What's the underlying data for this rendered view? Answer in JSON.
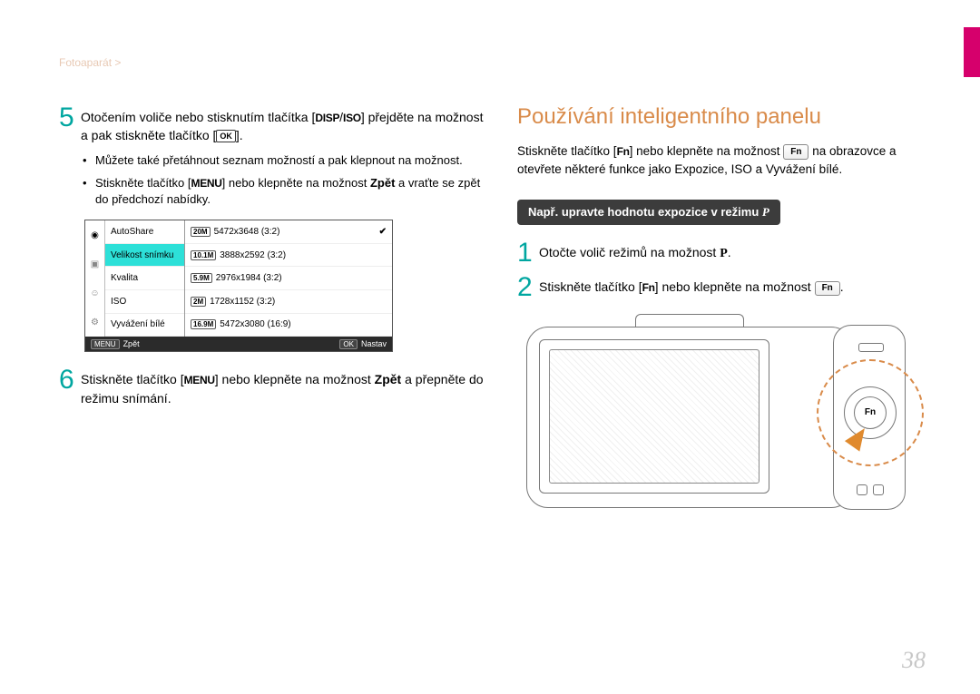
{
  "breadcrumb": "Fotoaparát >",
  "page_number": "38",
  "left": {
    "step5": {
      "num": "5",
      "pre": "Otočením voliče nebo stisknutím tlačítka [",
      "disp": "DISP",
      "slash": "/",
      "iso": "ISO",
      "mid": "] přejděte na možnost a pak stiskněte tlačítko [",
      "ok": "OK",
      "post": "]."
    },
    "bullets": {
      "b1": "Můžete také přetáhnout seznam možností a pak klepnout na možnost.",
      "b2_pre": "Stiskněte tlačítko [",
      "b2_menu": "MENU",
      "b2_mid": "] nebo klepněte na možnost ",
      "b2_zpet": "Zpět",
      "b2_post": " a vraťte se zpět do předchozí nabídky."
    },
    "lcd": {
      "items": [
        "AutoShare",
        "Velikost snímku",
        "Kvalita",
        "ISO",
        "Vyvážení bílé"
      ],
      "opts": [
        {
          "tag": "20M",
          "label": "5472x3648 (3:2)",
          "chk": true
        },
        {
          "tag": "10.1M",
          "label": "3888x2592 (3:2)",
          "chk": false
        },
        {
          "tag": "5.9M",
          "label": "2976x1984 (3:2)",
          "chk": false
        },
        {
          "tag": "2M",
          "label": "1728x1152 (3:2)",
          "chk": false
        },
        {
          "tag": "16.9M",
          "label": "5472x3080 (16:9)",
          "chk": false
        }
      ],
      "foot_left_btn": "MENU",
      "foot_left": "Zpět",
      "foot_right_btn": "OK",
      "foot_right": "Nastav"
    },
    "step6": {
      "num": "6",
      "pre": "Stiskněte tlačítko [",
      "menu": "MENU",
      "mid": "] nebo klepněte na možnost ",
      "zpet": "Zpět",
      "post": " a přepněte do režimu snímání."
    }
  },
  "right": {
    "heading": "Používání inteligentního panelu",
    "intro_pre": "Stiskněte tlačítko [",
    "intro_fn": "Fn",
    "intro_mid1": "] nebo klepněte na možnost ",
    "intro_fnbox": "Fn",
    "intro_mid2": " na obrazovce a otevřete některé funkce jako Expozice, ISO a Vyvážení bílé.",
    "subhead_pre": "Např. upravte hodnotu expozice v režimu ",
    "subhead_p": "P",
    "step1": {
      "num": "1",
      "pre": "Otočte volič režimů na možnost ",
      "p": "P",
      "post": "."
    },
    "step2": {
      "num": "2",
      "pre": "Stiskněte tlačítko [",
      "fn": "Fn",
      "mid": "] nebo klepněte na možnost ",
      "fnbox": "Fn",
      "post": "."
    },
    "dial_label": "Fn"
  }
}
